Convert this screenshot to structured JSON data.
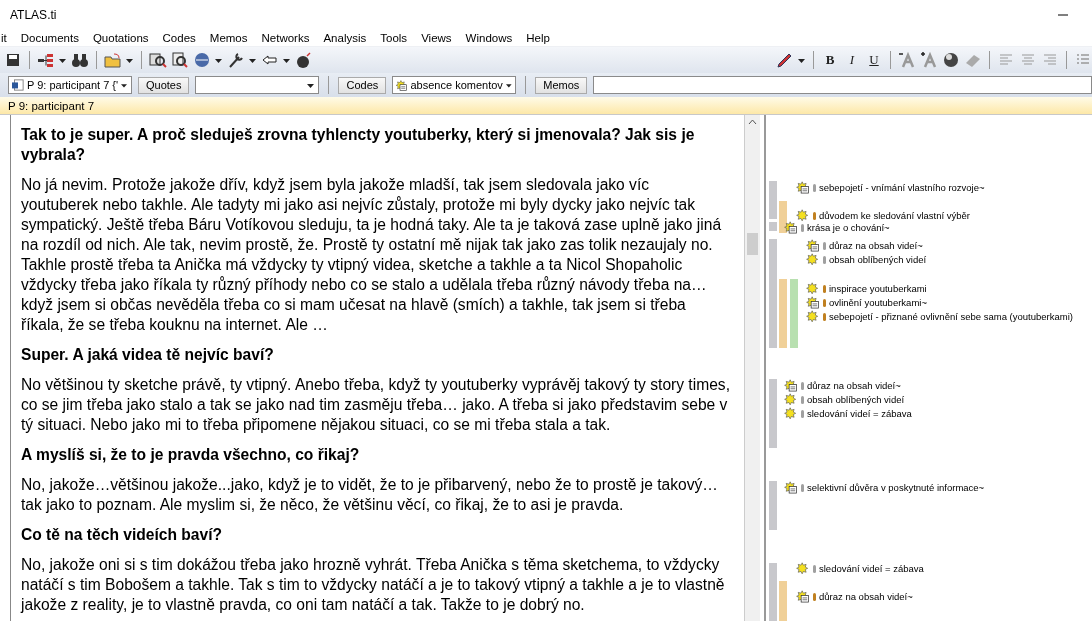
{
  "window": {
    "title": "ATLAS.ti"
  },
  "menu": [
    "it",
    "Documents",
    "Quotations",
    "Codes",
    "Memos",
    "Networks",
    "Analysis",
    "Tools",
    "Views",
    "Windows",
    "Help"
  ],
  "format_buttons": [
    {
      "label": "B",
      "kind": "bold"
    },
    {
      "label": "I",
      "kind": "italic"
    },
    {
      "label": "U",
      "kind": "underline"
    }
  ],
  "selector_bar": {
    "document": "P 9: participant 7 {'",
    "quotes_button": "Quotes",
    "codes_button": "Codes",
    "code_filter": "absence komentov",
    "memos_button": "Memos"
  },
  "document_title": "P 9: participant 7",
  "paragraphs": [
    {
      "kind": "question",
      "text": "Tak to je super. A proč sleduješ zrovna tyhlencty youtuberky, který si jmenovala? Jak sis je vybrala?"
    },
    {
      "kind": "answer",
      "text": "No já nevim. Protože jakože dřív, když jsem byla jakože mladší, tak jsem sledovala jako víc youtuberek nebo takhle. Ale tadyty mi jako asi nejvíc zůstaly, protože mi byly dycky jako nejvíc tak sympatický. Ještě třeba Báru Votíkovou sleduju, ta je hodná taky. Ale ta je taková zase uplně jako jiná na rozdíl od nich. Ale tak, nevim prostě, že. Prostě ty ostatní mě nijak tak jako zas tolik nezaujaly no. Takhle prostě třeba ta Anička má vždycky ty vtipný videa, sketche a takhle a ta Nicol Shopaholic vždycky třeba jako říkala ty různý příhody nebo co se stalo a udělala třeba různý návody třeba na…když jsem si občas nevěděla třeba co si mam učesat na hlavě (smích) a takhle, tak jsem si třeba říkala, že se třeba kouknu na internet. Ale …"
    },
    {
      "kind": "question",
      "text": "Super. A jaká videa tě nejvíc baví?"
    },
    {
      "kind": "answer",
      "text": "No většinou ty sketche právě, ty vtipný. Anebo třeba, když ty youtuberky vyprávěj takový ty story times, co se jim třeba jako stalo a tak se jako nad tim zasměju třeba… jako. A třeba si jako představim sebe v tý situaci. Nebo jako mi to třeba připomene nějakou situaci, co se mi třeba stala a tak."
    },
    {
      "kind": "question",
      "text": "A myslíš si, že to je pravda všechno, co řikaj?"
    },
    {
      "kind": "answer",
      "text": "No, jakože…většinou jakože...jako, když je to vidět, že to je přibarvený, nebo že to prostě je takový…tak jako to poznam. Ale myslim si, že něco, že většinu věcí, co řikaj, že to asi je pravda."
    },
    {
      "kind": "question",
      "text": "Co tě na těch videích baví?"
    },
    {
      "kind": "answer",
      "text": "No, jakože oni si s tim dokážou třeba jako hrozně vyhrát. Třeba Anička s těma sketchema, to vždycky natáčí s tim Bobošem a takhle. Tak s tim to vždycky natáčí a je to takový vtipný a takhle a je to vlastně jakože z reality, je to vlastně pravda, co oni tam natáčí a tak. Takže to je dobrý no."
    }
  ],
  "margin_bars": [
    {
      "color": "#c8c8cc"
    },
    {
      "color": "#f0d098"
    },
    {
      "color": "#c8c8cc"
    },
    {
      "color": "#c8c8cc"
    },
    {
      "color": "#f0d098"
    },
    {
      "color": "#b8e0b0"
    },
    {
      "color": "#c8c8cc"
    },
    {
      "color": "#c8c8cc"
    },
    {
      "color": "#c8c8cc"
    },
    {
      "color": "#f0d098"
    }
  ],
  "margin_codes": [
    {
      "kind": "memo",
      "color": "#a0a0a0",
      "text": "sebepojetí - vnímání vlastního rozvoje~"
    },
    {
      "kind": "code",
      "color": "#c08020",
      "text": "důvodem ke sledování vlastní výběr"
    },
    {
      "kind": "memo",
      "color": "#a0a0a0",
      "text": "krása je o chování~"
    },
    {
      "kind": "memo",
      "color": "#a0a0a0",
      "text": "důraz na obsah videí~"
    },
    {
      "kind": "code",
      "color": "#a0a0a0",
      "text": "obsah oblíbených videí"
    },
    {
      "kind": "code",
      "color": "#c08020",
      "text": "inspirace youtuberkami"
    },
    {
      "kind": "memo",
      "color": "#c08020",
      "text": "ovlinění youtuberkami~"
    },
    {
      "kind": "code",
      "color": "#c08020",
      "text": "sebepojetí - přiznané ovlivnění sebe sama (youtuberkami)"
    },
    {
      "kind": "memo",
      "color": "#a0a0a0",
      "text": "důraz na obsah videí~"
    },
    {
      "kind": "code",
      "color": "#a0a0a0",
      "text": "obsah oblíbených videí"
    },
    {
      "kind": "code",
      "color": "#a0a0a0",
      "text": "sledování videí = zábava"
    },
    {
      "kind": "memo",
      "color": "#a0a0a0",
      "text": "selektivní důvěra v poskytnuté informace~"
    },
    {
      "kind": "code",
      "color": "#a0a0a0",
      "text": "sledování videí = zábava"
    },
    {
      "kind": "memo",
      "color": "#c08020",
      "text": "důraz na obsah videí~"
    }
  ]
}
